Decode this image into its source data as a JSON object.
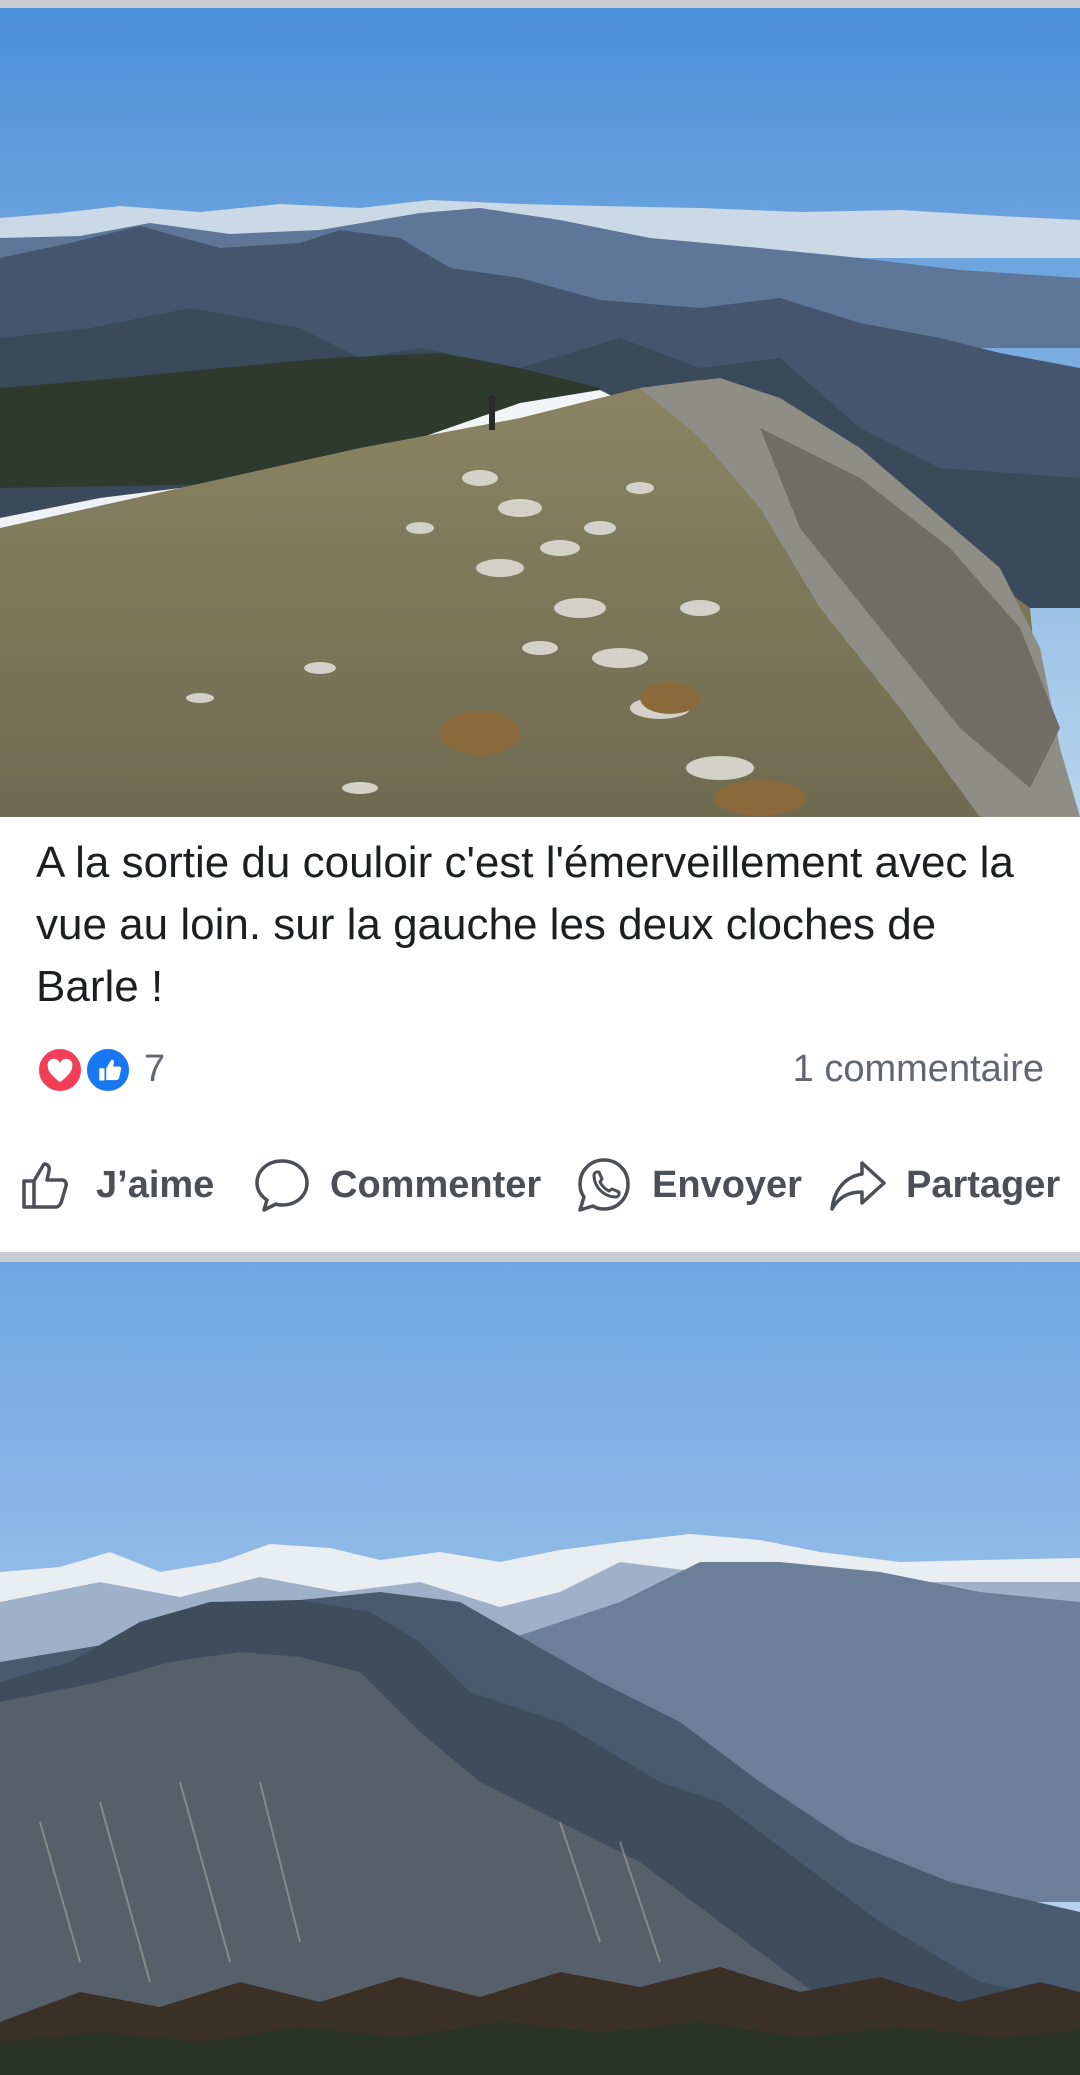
{
  "post": {
    "caption": "A la sortie du couloir c'est l'émerveillement avec la vue au loin. sur la gauche les deux cloches de Barle !",
    "reaction_icons": [
      "heart-icon",
      "thumbs-up-icon"
    ],
    "reaction_count": "7",
    "comment_count": "1 commentaire",
    "actions": {
      "like_label": "J’aime",
      "comment_label": "Commenter",
      "send_label": "Envoyer",
      "share_label": "Partager"
    }
  },
  "colors": {
    "love": "#f33e58",
    "like": "#1877f2",
    "text_primary": "#1c1e21",
    "text_secondary": "#606770",
    "action_text": "#4b4f56",
    "divider": "#c9ccd1"
  }
}
